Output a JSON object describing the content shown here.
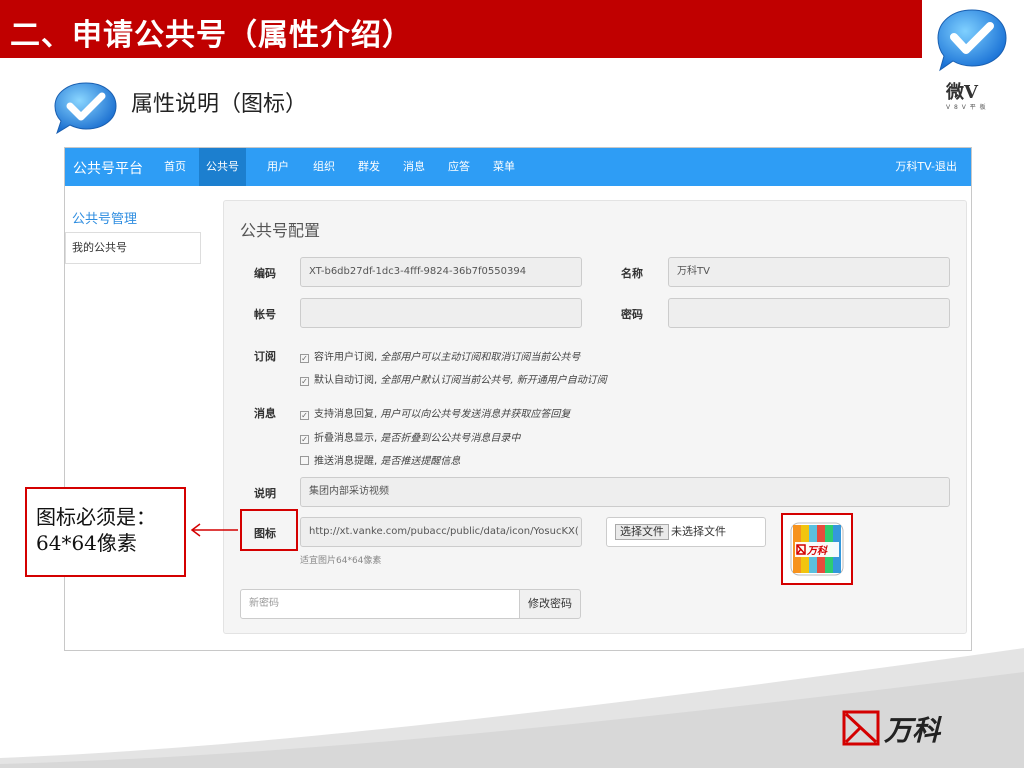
{
  "slide": {
    "title": "二、申请公共号（属性介绍）",
    "subtitle": "属性说明（图标）",
    "brand_name": "微V",
    "brand_sub": "V 8 V 平 板",
    "footer_brand": "万科",
    "callout": "图标必须是：64*64像素"
  },
  "colors": {
    "banner": "#c00000",
    "nav": "#2e9df5",
    "nav_active": "#1c7fcf",
    "highlight": "#d40000"
  },
  "app": {
    "nav": {
      "brand": "公共号平台",
      "items": [
        "首页",
        "公共号",
        "用户",
        "组织",
        "群发",
        "消息",
        "应答",
        "菜单"
      ],
      "active": "公共号",
      "user": "万科TV-退出"
    },
    "sidebar": {
      "heading": "公共号管理",
      "items": [
        "我的公共号"
      ]
    },
    "panel": {
      "title": "公共号配置",
      "code_label": "编码",
      "code_value": "XT-b6db27df-1dc3-4fff-9824-36b7f0550394",
      "name_label": "名称",
      "name_value": "万科TV",
      "account_label": "帐号",
      "account_value": "",
      "password_label": "密码",
      "password_value": "",
      "subscribe_label": "订阅",
      "subscribe_opts": [
        {
          "checked": true,
          "text": "容许用户订阅,",
          "note": " 全部用户可以主动订阅和取消订阅当前公共号"
        },
        {
          "checked": true,
          "text": "默认自动订阅,",
          "note": " 全部用户默认订阅当前公共号, 新开通用户自动订阅"
        }
      ],
      "message_label": "消息",
      "message_opts": [
        {
          "checked": true,
          "text": "支持消息回复,",
          "note": " 用户可以向公共号发送消息并获取应答回复"
        },
        {
          "checked": true,
          "text": "折叠消息显示,",
          "note": " 是否折叠到公公共号消息目录中"
        },
        {
          "checked": false,
          "text": "推送消息提醒,",
          "note": " 是否推送提醒信息"
        }
      ],
      "desc_label": "说明",
      "desc_value": "集团内部采访视频",
      "icon_label": "图标",
      "icon_url": "http://xt.vanke.com/pubacc/public/data/icon/YosucKX(",
      "file_button": "选择文件",
      "file_status": "未选择文件",
      "icon_hint": "适宜图片64*64像素",
      "icon_preview_text": "万科",
      "new_password_placeholder": "新密码",
      "change_password_button": "修改密码"
    }
  }
}
